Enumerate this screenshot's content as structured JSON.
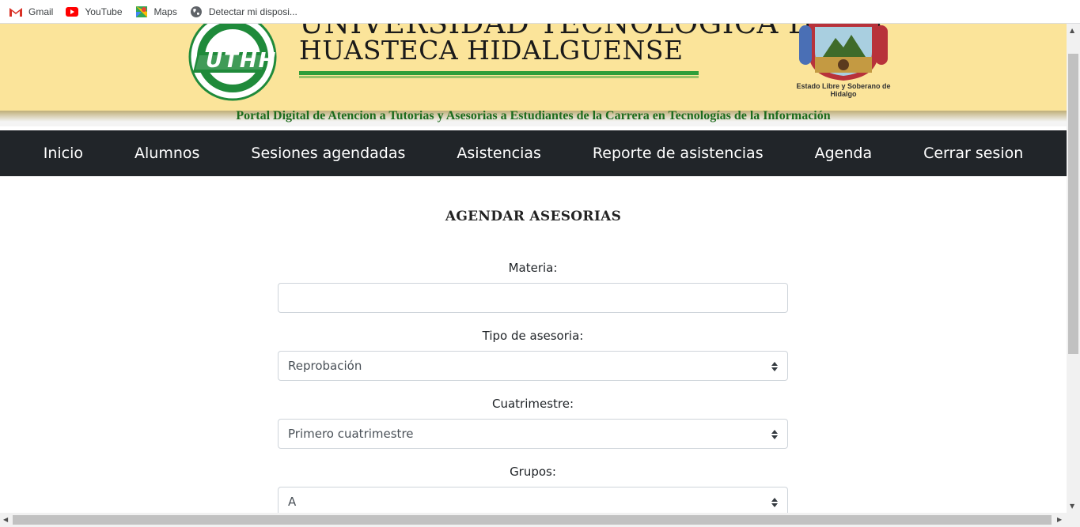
{
  "bookmarks": [
    {
      "label": "Gmail",
      "icon": "gmail-icon"
    },
    {
      "label": "YouTube",
      "icon": "youtube-icon"
    },
    {
      "label": "Maps",
      "icon": "maps-icon"
    },
    {
      "label": "Detectar mi disposi...",
      "icon": "globe-icon"
    }
  ],
  "header": {
    "university_line1": "UNIVERSIDAD TECNOLOGICA DE LA",
    "university_line2": "HUASTECA HIDALGUENSE",
    "logo_text": "UTHH",
    "crest_caption": "Estado Libre y Soberano de Hidalgo",
    "portal_subtitle": "Portal Digital de Atencion a Tutorias y Asesorias a Estudiantes de la Carrera en Tecnologías de la Información"
  },
  "nav": {
    "items": [
      "Inicio",
      "Alumnos",
      "Sesiones agendadas",
      "Asistencias",
      "Reporte de asistencias",
      "Agenda",
      "Cerrar sesion"
    ]
  },
  "form": {
    "title": "AGENDAR ASESORIAS",
    "materia_label": "Materia:",
    "materia_value": "",
    "tipo_label": "Tipo de asesoria:",
    "tipo_value": "Reprobación",
    "cuatrimestre_label": "Cuatrimestre:",
    "cuatrimestre_value": "Primero cuatrimestre",
    "grupos_label": "Grupos:",
    "grupos_value": "A"
  },
  "colors": {
    "banner": "#fbe49a",
    "navbar": "#212529",
    "subtitle": "#1d6b1d",
    "accent_green": "#2e9e3a"
  }
}
